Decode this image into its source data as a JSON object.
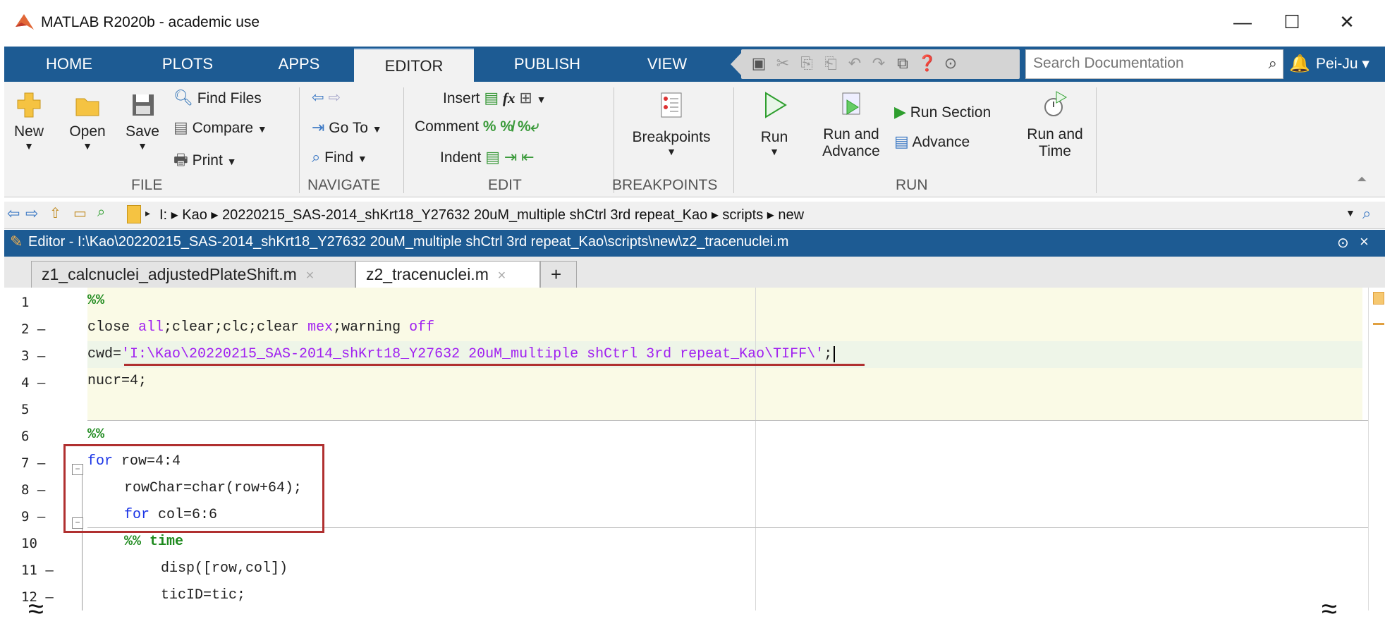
{
  "window": {
    "title": "MATLAB R2020b - academic use",
    "minimize": "—",
    "maximize": "☐",
    "close": "✕"
  },
  "ribbon_tabs": [
    "HOME",
    "PLOTS",
    "APPS",
    "EDITOR",
    "PUBLISH",
    "VIEW"
  ],
  "search": {
    "placeholder": "Search Documentation"
  },
  "user": {
    "name": "Pei-Ju ▾"
  },
  "file_group": {
    "label": "FILE",
    "new": "New",
    "open": "Open",
    "save": "Save",
    "find_files": "Find Files",
    "compare": "Compare",
    "print": "Print"
  },
  "navigate_group": {
    "label": "NAVIGATE",
    "go_to": "Go To",
    "find": "Find"
  },
  "edit_group": {
    "label": "EDIT",
    "insert": "Insert",
    "comment": "Comment",
    "indent": "Indent"
  },
  "breakpoints_group": {
    "label": "BREAKPOINTS",
    "breakpoints": "Breakpoints"
  },
  "run_group": {
    "label": "RUN",
    "run": "Run",
    "run_and_advance_1": "Run and",
    "run_and_advance_2": "Advance",
    "run_section": "Run Section",
    "advance": "Advance",
    "run_and_time_1": "Run and",
    "run_and_time_2": "Time"
  },
  "address": {
    "path": "I: ▸ Kao ▸ 20220215_SAS-2014_shKrt18_Y27632 20uM_multiple shCtrl 3rd repeat_Kao ▸ scripts ▸ new"
  },
  "editor": {
    "title": "Editor - I:\\Kao\\20220215_SAS-2014_shKrt18_Y27632 20uM_multiple shCtrl 3rd repeat_Kao\\scripts\\new\\z2_tracenuclei.m",
    "tabs": [
      {
        "label": "z1_calcnuclei_adjustedPlateShift.m",
        "close": "×"
      },
      {
        "label": "z2_tracenuclei.m",
        "close": "×"
      }
    ],
    "add_tab": "+"
  },
  "code": {
    "line_numbers": [
      "1",
      "2 –",
      "3 –",
      "4 –",
      "5",
      "6",
      "7 –",
      "8 –",
      "9 –",
      "10",
      "11 –",
      "12 –"
    ],
    "l1": "%%",
    "l2a": "close ",
    "l2b": "all",
    "l2c": ";clear;clc;clear ",
    "l2d": "mex",
    "l2e": ";warning ",
    "l2f": "off",
    "l3a": "cwd=",
    "l3b": "'I:\\Kao\\20220215_SAS-2014_shKrt18_Y27632 20uM_multiple shCtrl 3rd repeat_Kao\\TIFF\\'",
    "l3c": ";",
    "l4": "nucr=4;",
    "l6": "%%",
    "l7a": "for",
    "l7b": " row=4:4",
    "l8": "rowChar=char(row+64);",
    "l9a": "for",
    "l9b": " col=6:6",
    "l10": "%% time",
    "l11": "disp([row,col])",
    "l12": "ticID=tic;"
  }
}
